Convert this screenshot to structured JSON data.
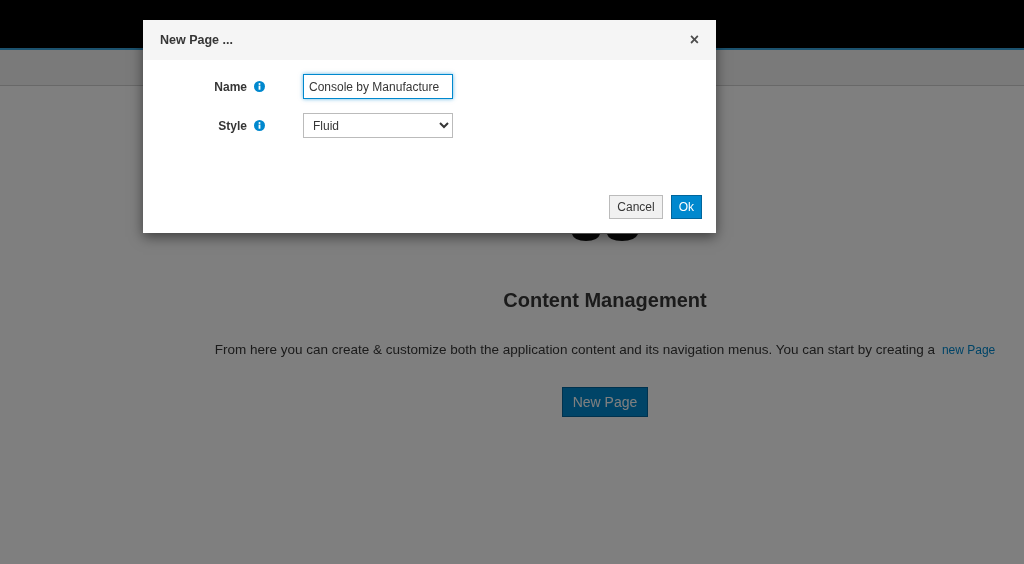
{
  "page": {
    "heading": "Content Management",
    "text": "From here you can create & customize both the application content and its navigation menus. You can start by creating a",
    "link": "new Page",
    "button": "New Page"
  },
  "dialog": {
    "title": "New Page ...",
    "close": "×",
    "fields": [
      {
        "label": "Name",
        "kind": "text",
        "value": "Console by Manufacture",
        "focused": true
      },
      {
        "label": "Style",
        "kind": "select",
        "value": "Fluid",
        "focused": false
      }
    ],
    "buttons": [
      {
        "label": "Cancel",
        "kind": "default"
      },
      {
        "label": "Ok",
        "kind": "primary"
      }
    ]
  }
}
